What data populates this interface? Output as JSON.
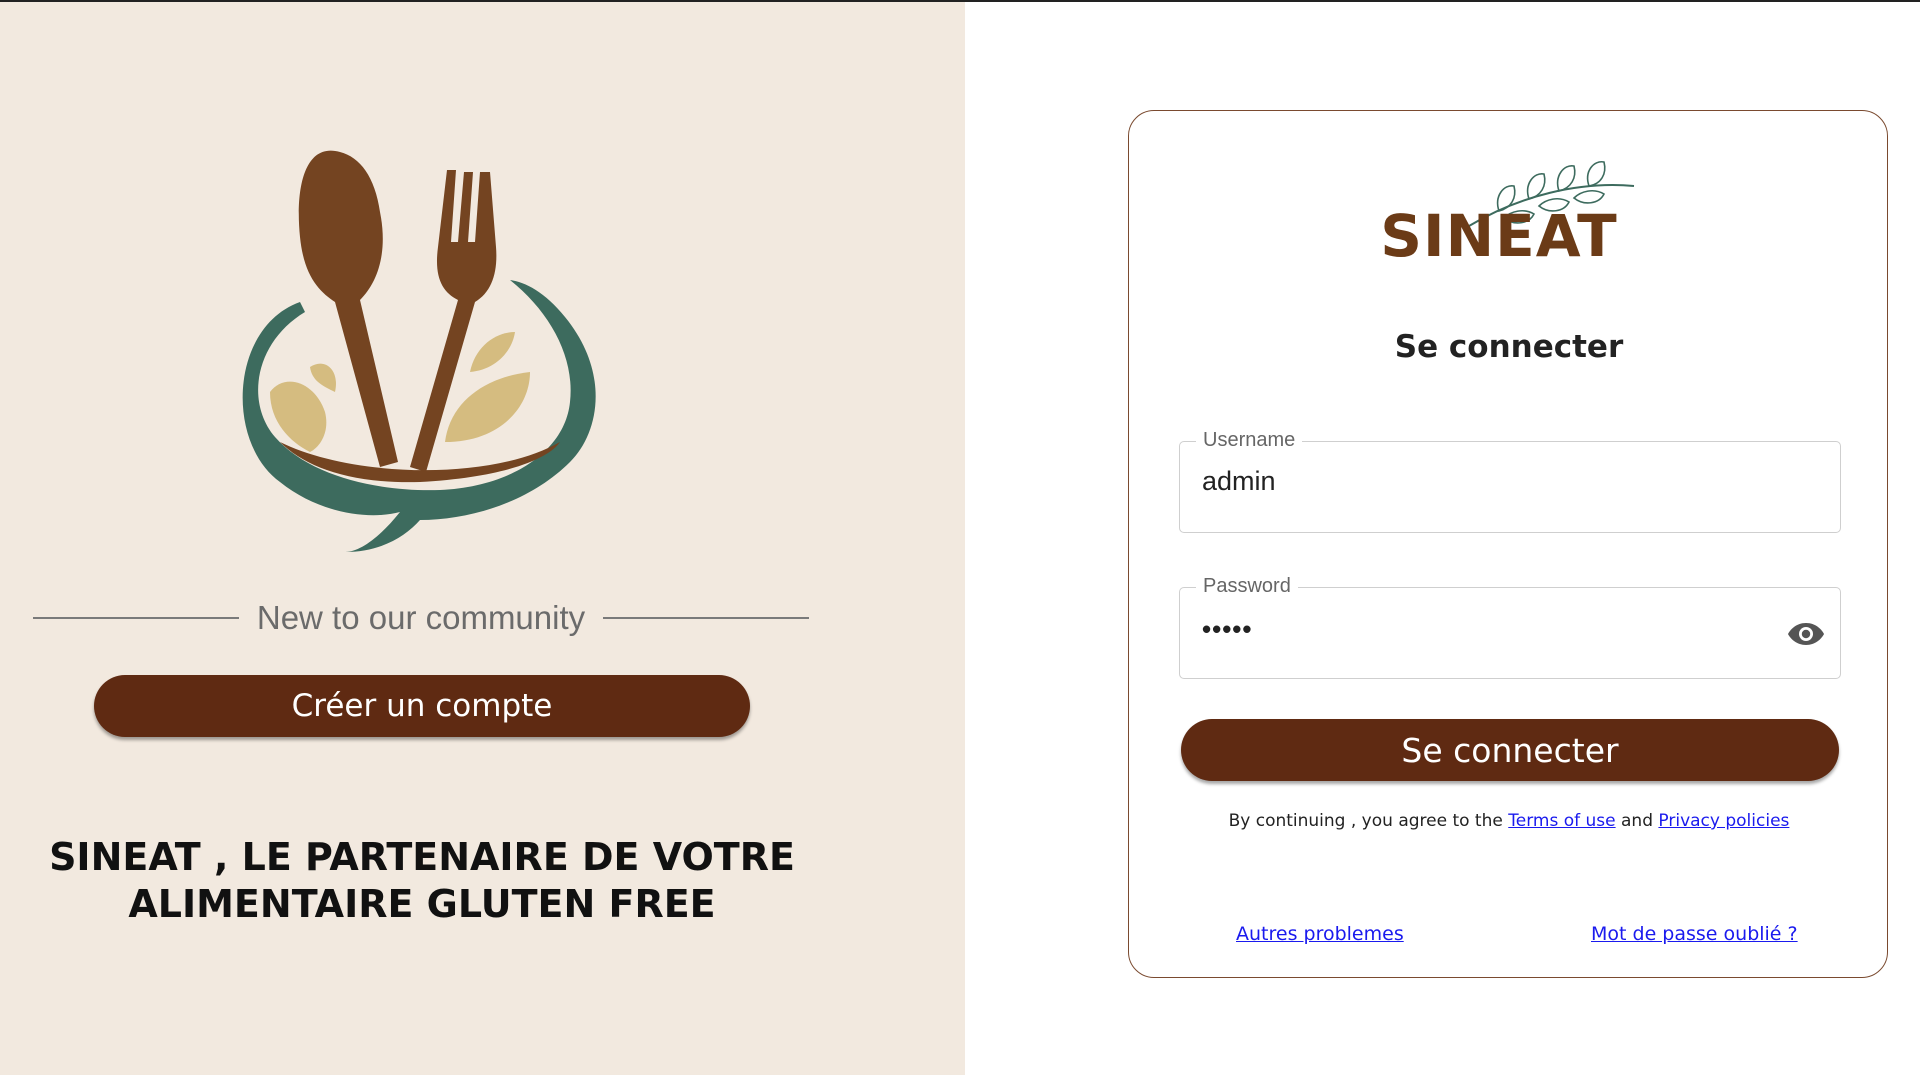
{
  "left": {
    "community_text": "New to our community",
    "create_account_label": "Créer un compte",
    "tagline_line1": "SINEAT , LE PARTENAIRE DE VOTRE",
    "tagline_line2": "ALIMENTAIRE GLUTEN FREE"
  },
  "card": {
    "brand": "SINEAT",
    "title": "Se connecter",
    "username": {
      "label": "Username",
      "value": "admin"
    },
    "password": {
      "label": "Password",
      "value": "•••••"
    },
    "login_label": "Se connecter",
    "terms_prefix": "By continuing , you agree to the ",
    "terms_link": "Terms of use",
    "terms_and": " and ",
    "privacy_link": "Privacy policies",
    "link_other": "Autres problemes",
    "link_forgot": "Mot de passe oublié ?"
  },
  "icons": {
    "eye": "eye-icon",
    "hero": "spoon-fork-logo",
    "leaves": "leaf-branch-icon"
  },
  "colors": {
    "brand_brown": "#5f2a12",
    "logo_brown": "#6b3b17",
    "left_bg": "#f2e9df",
    "teal": "#3d6b5e",
    "wheat": "#d5bc80"
  }
}
